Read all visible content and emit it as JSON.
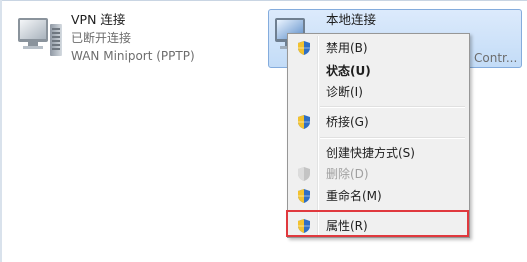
{
  "connections": {
    "vpn": {
      "name": "VPN 连接",
      "status": "已断开连接",
      "device": "WAN Miniport (PPTP)",
      "icon": "network-computer-icon"
    },
    "local": {
      "name": "本地连接",
      "device_truncated": "Contr...",
      "icon": "network-computer-icon"
    }
  },
  "context_menu": {
    "items": [
      {
        "label": "禁用(B)",
        "icon": "uac-shield-icon",
        "style": "normal"
      },
      {
        "label": "状态(U)",
        "icon": "",
        "style": "bold"
      },
      {
        "label": "诊断(I)",
        "icon": "",
        "style": "normal"
      },
      {
        "label": "桥接(G)",
        "icon": "uac-shield-icon",
        "style": "normal"
      },
      {
        "label": "创建快捷方式(S)",
        "icon": "",
        "style": "normal"
      },
      {
        "label": "删除(D)",
        "icon": "uac-shield-icon",
        "style": "disabled"
      },
      {
        "label": "重命名(M)",
        "icon": "uac-shield-icon",
        "style": "normal"
      },
      {
        "label": "属性(R)",
        "icon": "uac-shield-icon",
        "style": "normal"
      }
    ]
  },
  "colors": {
    "selection": "#c3dcf7",
    "highlight_box": "#e0393e",
    "menu_bg": "#f0f0f0"
  }
}
